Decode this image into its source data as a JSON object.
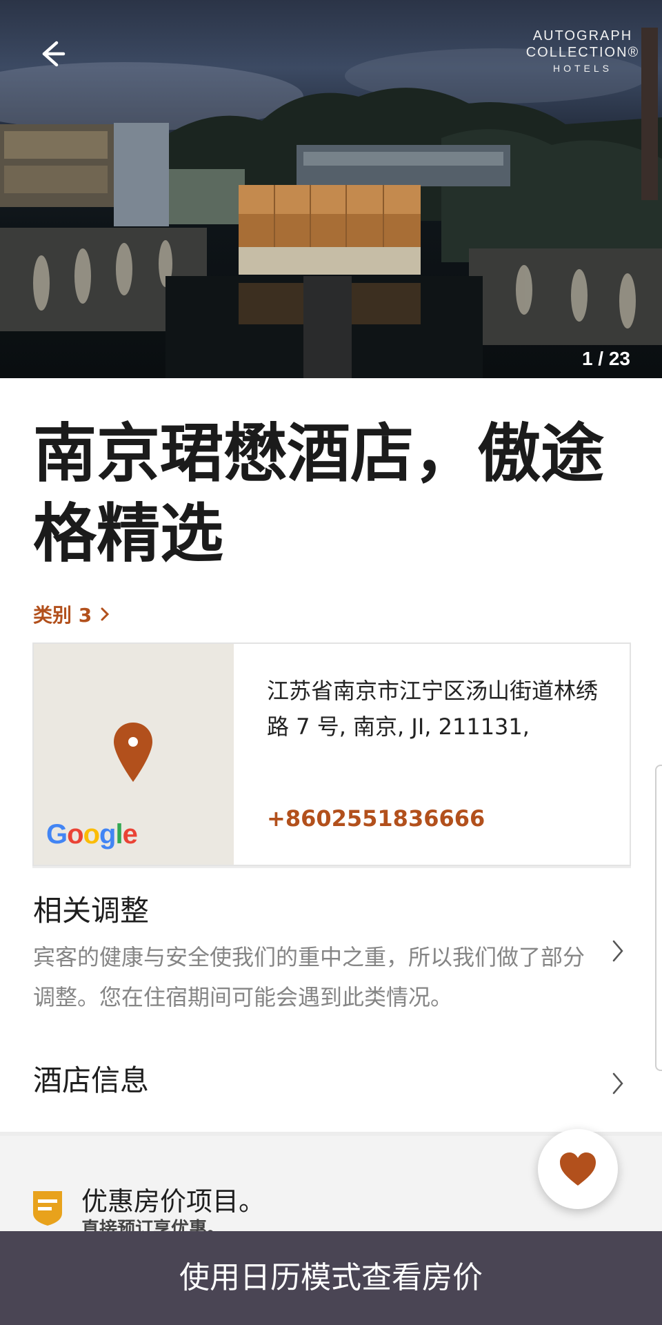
{
  "hero": {
    "brand_line1": "AUTOGRAPH",
    "brand_line2": "COLLECTION®",
    "brand_line3": "HOTELS",
    "building_sign": "AUTOGRAPH COLLECTION",
    "photo_counter": "1 / 23",
    "back_icon": "arrow-left-icon"
  },
  "hotel": {
    "name": "南京珺懋酒店，傲途格精选",
    "category": "类别 3",
    "address": "江苏省南京市江宁区汤山街道林绣路 7 号, 南京, JI, 211131,",
    "phone": "+8602551836666"
  },
  "map": {
    "attribution": "Google"
  },
  "adjustments": {
    "title": "相关调整",
    "description": "宾客的健康与安全使我们的重中之重，所以我们做了部分调整。您在住宿期间可能会遇到此类情况。"
  },
  "hotel_info": {
    "title": "酒店信息"
  },
  "promo": {
    "title": "优惠房价项目。",
    "subtitle": "直接预订享优惠。"
  },
  "cta": {
    "label": "使用日历模式查看房价"
  },
  "colors": {
    "accent": "#b2501c",
    "cta_background": "#4a4554"
  }
}
